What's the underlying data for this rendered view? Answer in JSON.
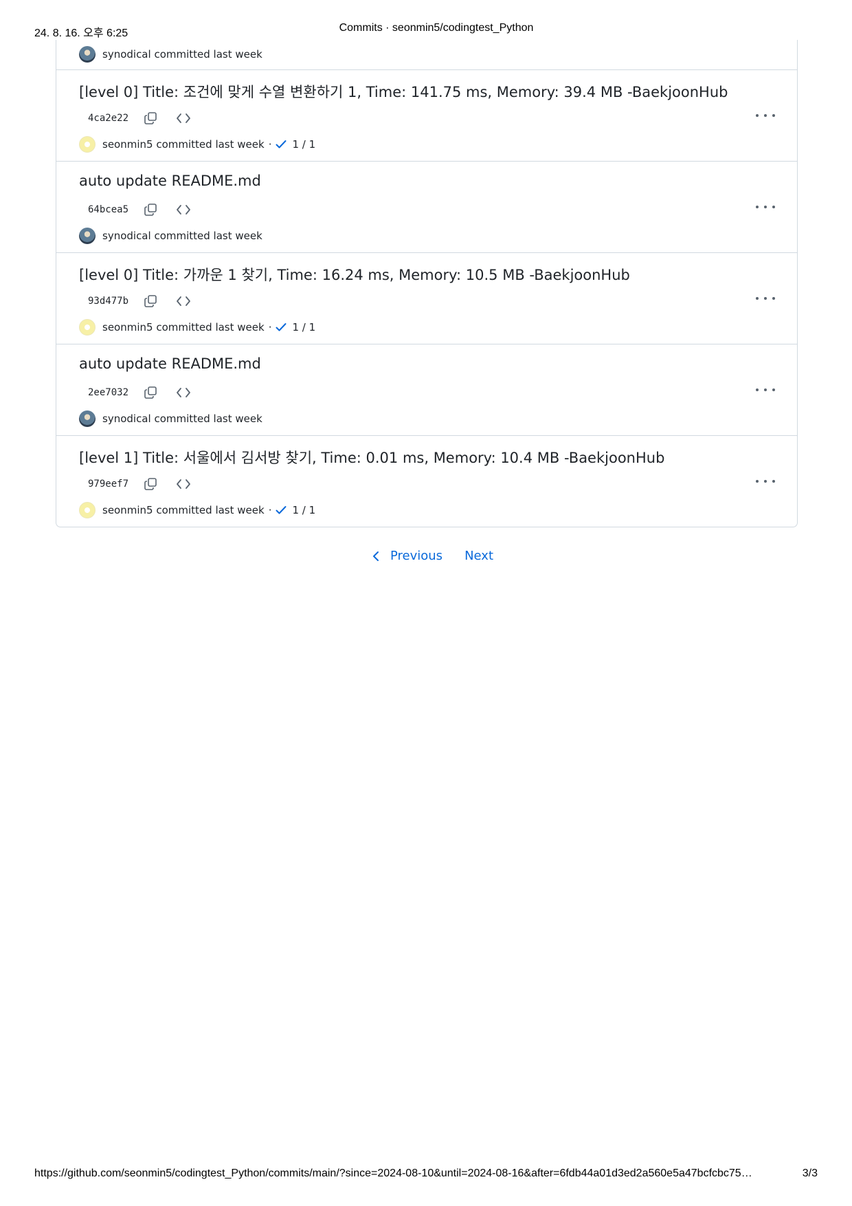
{
  "print_header": {
    "date": "24. 8. 16. 오후 6:25",
    "title": "Commits · seonmin5/codingtest_Python"
  },
  "commit_tail": {
    "author": "synodical",
    "committed_text": "committed last week"
  },
  "commits": [
    {
      "title": "[level 0] Title: 조건에 맞게 수열 변환하기 1, Time: 141.75 ms, Memory: 39.4 MB -BaekjoonHub",
      "sha": "4ca2e22",
      "author": "seonmin5",
      "committed_text": "committed last week",
      "separator": "·",
      "checks": "1 / 1"
    },
    {
      "title": "auto update README.md",
      "sha": "64bcea5",
      "author": "synodical",
      "committed_text": "committed last week"
    },
    {
      "title": "[level 0] Title: 가까운 1 찾기, Time: 16.24 ms, Memory: 10.5 MB -BaekjoonHub",
      "sha": "93d477b",
      "author": "seonmin5",
      "committed_text": "committed last week",
      "separator": "·",
      "checks": "1 / 1"
    },
    {
      "title": "auto update README.md",
      "sha": "2ee7032",
      "author": "synodical",
      "committed_text": "committed last week"
    },
    {
      "title": "[level 1] Title: 서울에서 김서방 찾기, Time: 0.01 ms, Memory: 10.4 MB -BaekjoonHub",
      "sha": "979eef7",
      "author": "seonmin5",
      "committed_text": "committed last week",
      "separator": "·",
      "checks": "1 / 1"
    }
  ],
  "pagination": {
    "previous_label": "Previous",
    "next_label": "Next"
  },
  "print_footer": {
    "url": "https://github.com/seonmin5/codingtest_Python/commits/main/?since=2024-08-10&until=2024-08-16&after=6fdb44a01d3ed2a560e5a47bcfcbc75…",
    "page": "3/3"
  },
  "colors": {
    "link": "#0969da",
    "border": "#d1d9e0",
    "text": "#1f2328",
    "muted_icon": "#59636e"
  },
  "icons": {
    "copy": "copy-icon",
    "browse": "code-icon",
    "check": "check-icon",
    "more": "kebab-horizontal-icon",
    "previous": "chevron-left-icon"
  }
}
